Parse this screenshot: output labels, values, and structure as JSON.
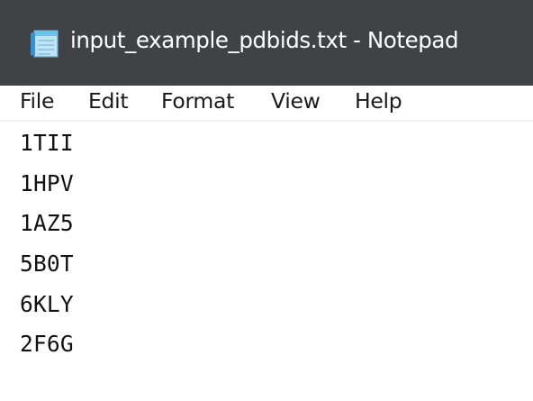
{
  "window": {
    "title": "input_example_pdbids.txt - Notepad",
    "app_icon": "notepad-icon",
    "title_bar_color": "#404245"
  },
  "menu": {
    "items": [
      "File",
      "Edit",
      "Format",
      "View",
      "Help"
    ]
  },
  "editor": {
    "lines": [
      "1TII",
      "1HPV",
      "1AZ5",
      "5B0T",
      "6KLY",
      "2F6G"
    ]
  }
}
